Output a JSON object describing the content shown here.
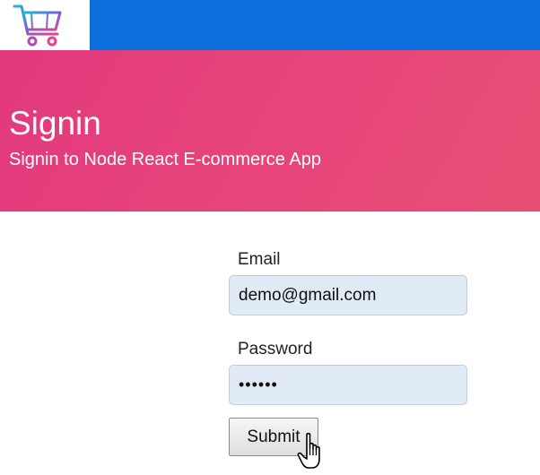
{
  "header": {
    "logo_icon": "shopping-cart-icon",
    "bar_color": "#0d6fdc"
  },
  "hero": {
    "title": "Signin",
    "subtitle": "Signin to Node React E-commerce App",
    "gradient_start": "#e2397d",
    "gradient_end": "#e84f74"
  },
  "form": {
    "email_label": "Email",
    "email_value": "demo@gmail.com",
    "password_label": "Password",
    "password_value": "••••••",
    "submit_label": "Submit"
  },
  "cursor": {
    "icon": "hand-pointer-cursor-icon"
  }
}
